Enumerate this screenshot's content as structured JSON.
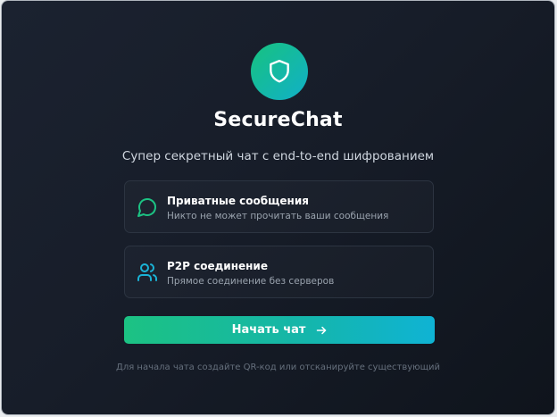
{
  "app": {
    "title": "SecureChat",
    "subtitle": "Супер секретный чат с end-to-end шифрованием"
  },
  "features": [
    {
      "icon": "chat-bubble-icon",
      "title": "Приватные сообщения",
      "description": "Никто не может прочитать ваши сообщения"
    },
    {
      "icon": "users-icon",
      "title": "P2P соединение",
      "description": "Прямое соединение без серверов"
    }
  ],
  "start_button": {
    "label": "Начать чат",
    "icon": "arrow-right-icon"
  },
  "footer": {
    "hint": "Для начала чата создайте QR-код или отсканируйте существующий"
  },
  "colors": {
    "background": "#171d29",
    "accent_green": "#1cc283",
    "accent_cyan": "#0fb3d4",
    "text_primary": "#ffffff",
    "text_secondary": "#9aa3ae"
  },
  "logo": {
    "icon": "shield-icon"
  }
}
